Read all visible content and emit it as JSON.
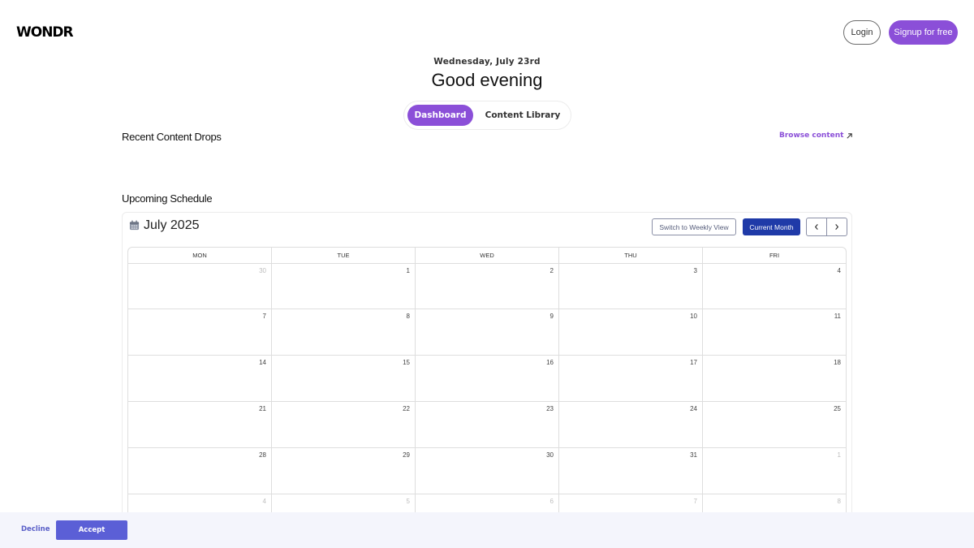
{
  "header": {
    "logo": "WONDR",
    "login_label": "Login",
    "signup_label": "Signup for free"
  },
  "hero": {
    "date": "Wednesday, July 23rd",
    "greeting": "Good evening"
  },
  "tabs": {
    "dashboard": "Dashboard",
    "content_library": "Content Library",
    "active": "Dashboard"
  },
  "recent": {
    "title": "Recent Content Drops",
    "browse_label": "Browse content"
  },
  "schedule": {
    "title": "Upcoming Schedule",
    "month": "July 2025",
    "weekly_label": "Switch to Weekly View",
    "current_label": "Current Month",
    "days": [
      "MON",
      "TUE",
      "WED",
      "THU",
      "FRI"
    ],
    "weeks": [
      [
        {
          "d": "30",
          "m": true
        },
        {
          "d": "1"
        },
        {
          "d": "2"
        },
        {
          "d": "3"
        },
        {
          "d": "4"
        }
      ],
      [
        {
          "d": "7"
        },
        {
          "d": "8"
        },
        {
          "d": "9"
        },
        {
          "d": "10"
        },
        {
          "d": "11"
        }
      ],
      [
        {
          "d": "14"
        },
        {
          "d": "15"
        },
        {
          "d": "16"
        },
        {
          "d": "17"
        },
        {
          "d": "18"
        }
      ],
      [
        {
          "d": "21"
        },
        {
          "d": "22"
        },
        {
          "d": "23"
        },
        {
          "d": "24"
        },
        {
          "d": "25"
        }
      ],
      [
        {
          "d": "28"
        },
        {
          "d": "29"
        },
        {
          "d": "30"
        },
        {
          "d": "31"
        },
        {
          "d": "1",
          "m": true
        }
      ],
      [
        {
          "d": "4",
          "m": true
        },
        {
          "d": "5",
          "m": true
        },
        {
          "d": "6",
          "m": true
        },
        {
          "d": "7",
          "m": true
        },
        {
          "d": "8",
          "m": true
        }
      ]
    ]
  },
  "cookie": {
    "decline_label": "Decline",
    "accept_label": "Accept"
  },
  "colors": {
    "brand": "#8b4fd8",
    "current_month_button": "#1f3aa8",
    "accept_button": "#5b5fd6"
  }
}
